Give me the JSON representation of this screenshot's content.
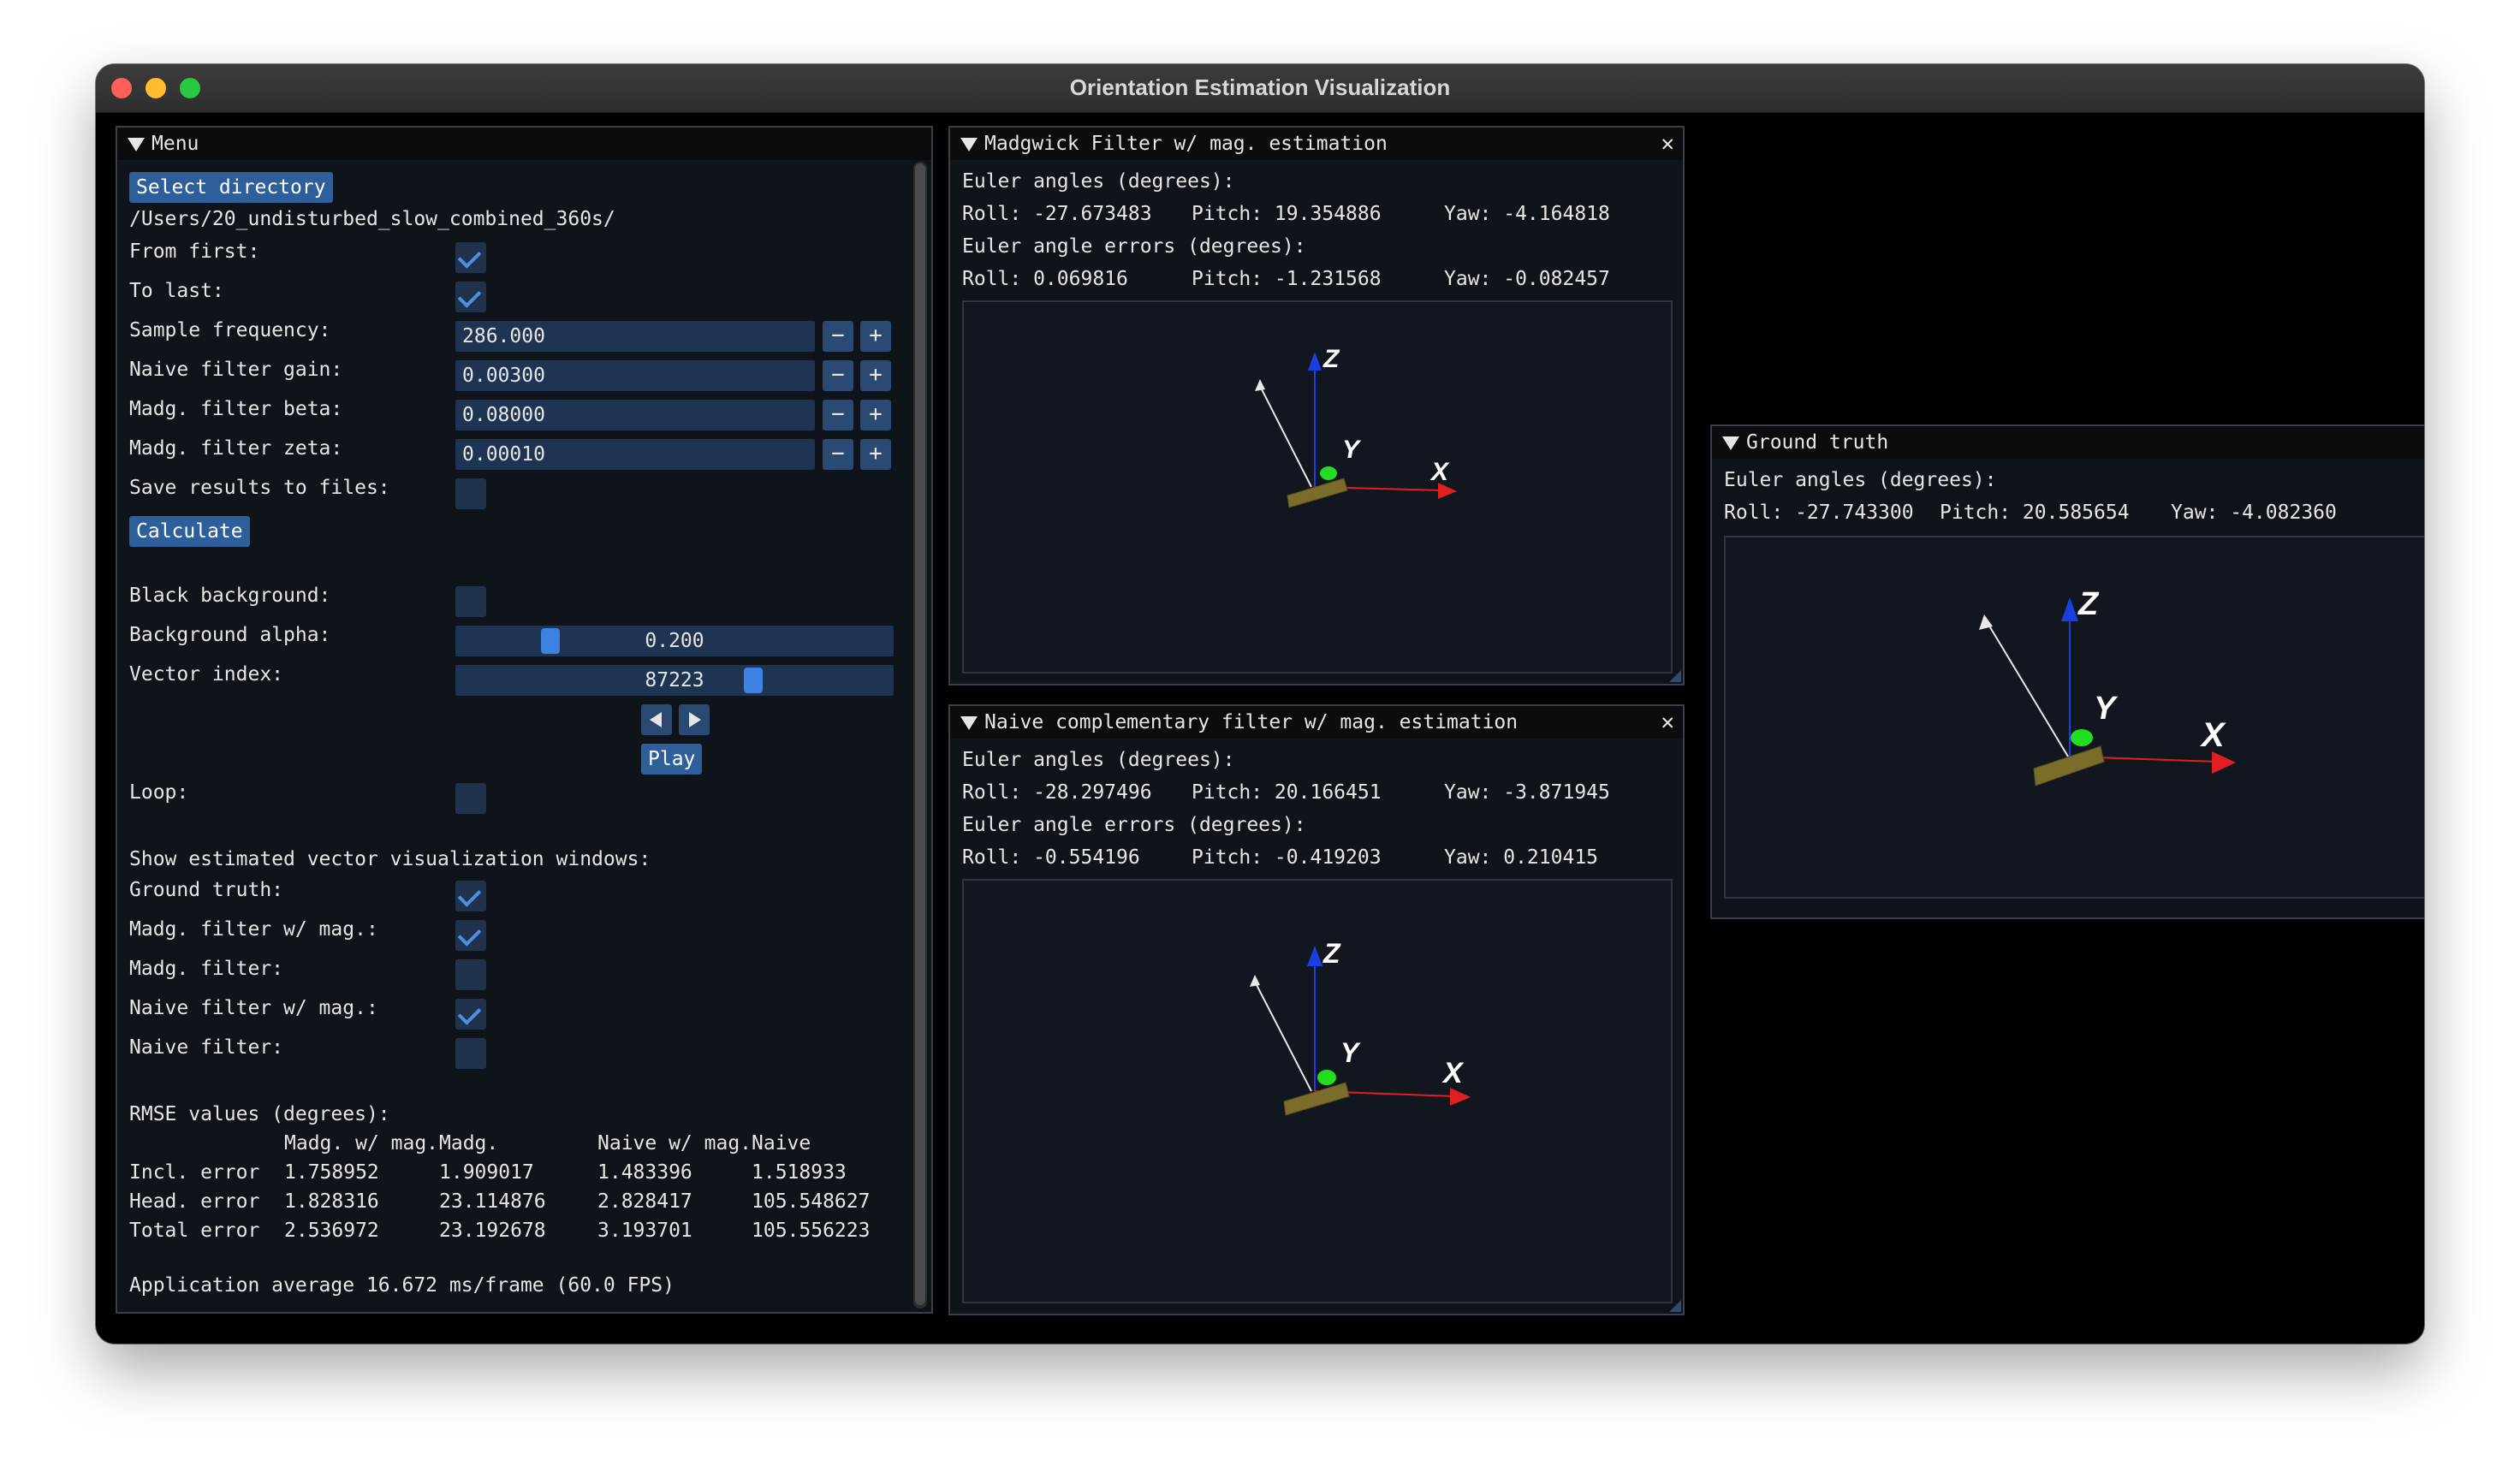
{
  "window": {
    "title": "Orientation Estimation Visualization"
  },
  "menu": {
    "title": "Menu",
    "select_directory": "Select directory",
    "directory_path": "/Users/20_undisturbed_slow_combined_360s/",
    "from_first": {
      "label": "From first:",
      "checked": true
    },
    "to_last": {
      "label": "To last:",
      "checked": true
    },
    "sample_frequency": {
      "label": "Sample frequency:",
      "value": "286.000"
    },
    "naive_filter_gain": {
      "label": "Naive filter gain:",
      "value": "0.00300"
    },
    "madg_filter_beta": {
      "label": "Madg. filter beta:",
      "value": "0.08000"
    },
    "madg_filter_zeta": {
      "label": "Madg. filter zeta:",
      "value": "0.00010"
    },
    "minus": "−",
    "plus": "+",
    "save_results": {
      "label": "Save results to files:",
      "checked": false
    },
    "calculate": "Calculate",
    "black_background": {
      "label": "Black background:",
      "checked": false
    },
    "background_alpha": {
      "label": "Background alpha:",
      "value": "0.200",
      "level": 0.2
    },
    "vector_index": {
      "label": "Vector index:",
      "value": "87223"
    },
    "play": "Play",
    "loop": {
      "label": "Loop:",
      "checked": false
    },
    "show_windows_heading": "Show estimated vector visualization windows:",
    "ground_truth": {
      "label": "Ground truth:",
      "checked": true
    },
    "madg_filter_mag": {
      "label": "Madg. filter w/ mag.:",
      "checked": true
    },
    "madg_filter": {
      "label": "Madg. filter:",
      "checked": false
    },
    "naive_filter_mag": {
      "label": "Naive filter w/ mag.:",
      "checked": true
    },
    "naive_filter": {
      "label": "Naive filter:",
      "checked": false
    },
    "rmse": {
      "heading": "RMSE values (degrees):",
      "columns": [
        "Madg. w/ mag.",
        "Madg.",
        "Naive w/ mag.",
        "Naive"
      ],
      "rows": [
        {
          "label": "Incl. error",
          "values": [
            "1.758952",
            "1.909017",
            "1.483396",
            "1.518933"
          ]
        },
        {
          "label": "Head. error",
          "values": [
            "1.828316",
            "23.114876",
            "2.828417",
            "105.548627"
          ]
        },
        {
          "label": "Total error",
          "values": [
            "2.536972",
            "23.192678",
            "3.193701",
            "105.556223"
          ]
        }
      ]
    },
    "fps": "Application average 16.672 ms/frame (60.0 FPS)"
  },
  "madgwick": {
    "title": "Madgwick Filter w/ mag. estimation",
    "angles_heading": "Euler angles (degrees):",
    "roll": "Roll: -27.673483",
    "pitch": "Pitch: 19.354886",
    "yaw": "Yaw: -4.164818",
    "errors_heading": "Euler angle errors (degrees):",
    "err_roll": "Roll: 0.069816",
    "err_pitch": "Pitch: -1.231568",
    "err_yaw": "Yaw: -0.082457",
    "axes": {
      "x": "X",
      "y": "Y",
      "z": "Z"
    }
  },
  "naive": {
    "title": "Naive complementary filter w/ mag. estimation",
    "angles_heading": "Euler angles (degrees):",
    "roll": "Roll: -28.297496",
    "pitch": "Pitch: 20.166451",
    "yaw": "Yaw: -3.871945",
    "errors_heading": "Euler angle errors (degrees):",
    "err_roll": "Roll: -0.554196",
    "err_pitch": "Pitch: -0.419203",
    "err_yaw": "Yaw: 0.210415",
    "axes": {
      "x": "X",
      "y": "Y",
      "z": "Z"
    }
  },
  "ground_truth": {
    "title": "Ground truth",
    "angles_heading": "Euler angles (degrees):",
    "roll": "Roll: -27.743300",
    "pitch": "Pitch: 20.585654",
    "yaw": "Yaw: -4.082360",
    "axes": {
      "x": "X",
      "y": "Y",
      "z": "Z"
    }
  },
  "colors": {
    "x_axis": "#e02020",
    "y_axis": "#22dd22",
    "z_axis": "#1a3fe0",
    "accent": "#3d82e0"
  }
}
